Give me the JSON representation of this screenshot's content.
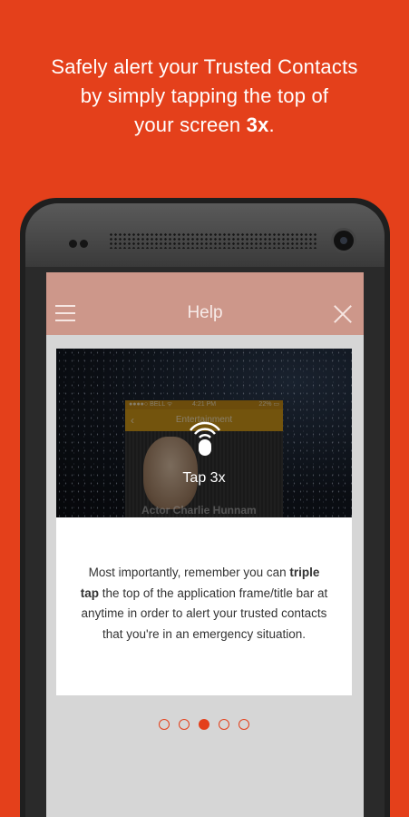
{
  "headline": {
    "line1": "Safely alert your Trusted Contacts",
    "line2": "by simply tapping the top of",
    "line3_prefix": "your screen ",
    "line3_bold": "3x",
    "line3_suffix": "."
  },
  "app_bar": {
    "title": "Help",
    "menu_icon": "hamburger-icon",
    "close_icon": "close-icon"
  },
  "card": {
    "mini_screen": {
      "status_left": "●●●●○ BELL ᯤ",
      "status_center": "4:21 PM",
      "status_right": "22% ▭",
      "nav_title": "Entertainment",
      "back": "‹",
      "name": "Actor Charlie Hunnam"
    },
    "tap_label": "Tap 3x",
    "body_prefix": "Most importantly, remember you can ",
    "body_bold": "triple tap",
    "body_suffix": " the top of the application frame/title bar at anytime in order to alert your trusted contacts that you're in an emergency situation."
  },
  "pager": {
    "count": 5,
    "active_index": 2
  },
  "colors": {
    "brand": "#e4401b",
    "app_bar": "#cd978a",
    "mini_accent": "#d19a19"
  }
}
